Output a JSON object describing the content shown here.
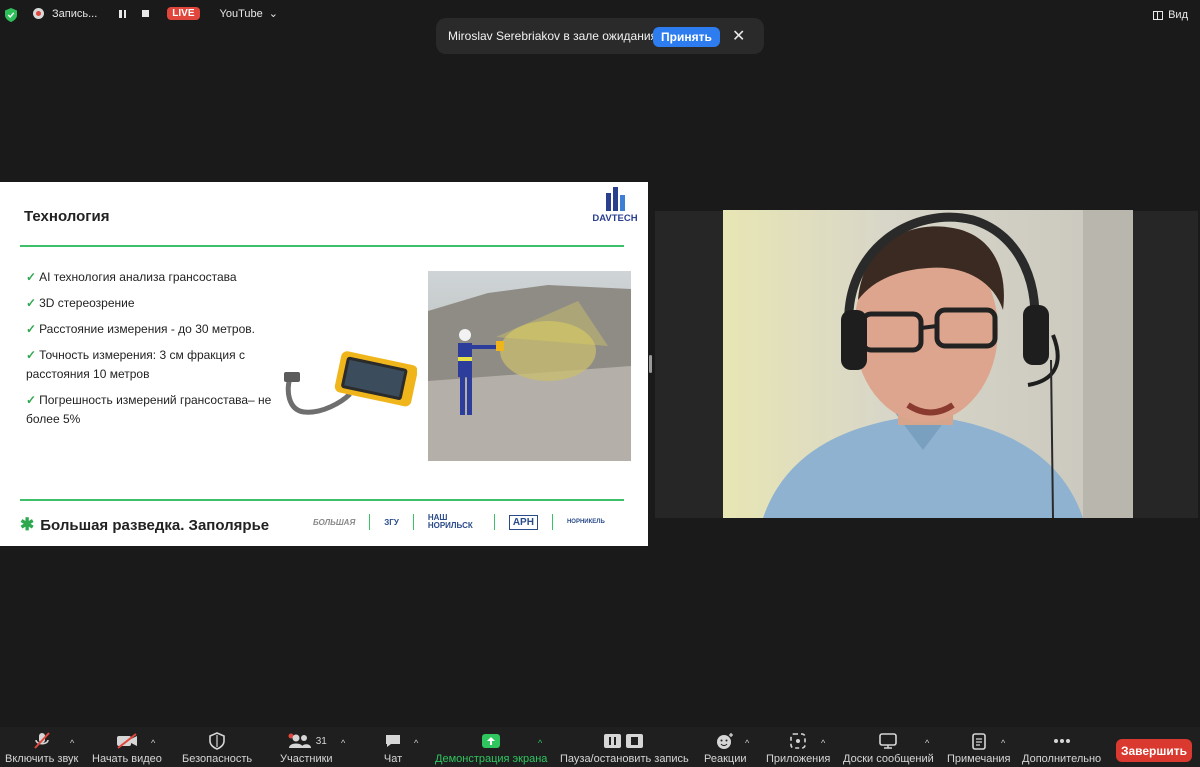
{
  "topbar": {
    "recording_label": "Запись...",
    "live_label": "LIVE",
    "stream_target": "YouTube",
    "view_label": "Вид"
  },
  "waiting_room": {
    "message": "Miroslav Serebriakov в зале ожидания",
    "accept_label": "Принять",
    "close_glyph": "✕"
  },
  "slide": {
    "title": "Технология",
    "brand": "DAVTECH",
    "bullets": [
      "AI технология анализа грансостава",
      "3D стереозрение",
      "Расстояние измерения - до 30 метров.",
      "Точность измерения: 3 см фракция с расстояния 10 метров",
      "Погрешность измерений грансостава– не более 5%"
    ],
    "footer_title": "Большая разведка. Заполярье",
    "footer_logos": [
      "БОЛЬШАЯ",
      "ЗГУ",
      "НАШ НОРИЛЬСК",
      "АРН",
      "НОРНИКЕЛЬ"
    ]
  },
  "toolbar": {
    "items": [
      {
        "label": "Включить звук",
        "icon": "mic-muted-icon"
      },
      {
        "label": "Начать видео",
        "icon": "video-off-icon"
      },
      {
        "label": "Безопасность",
        "icon": "shield-icon"
      },
      {
        "label": "Участники",
        "icon": "participants-icon",
        "count": "31"
      },
      {
        "label": "Чат",
        "icon": "chat-icon"
      },
      {
        "label": "Демонстрация экрана",
        "icon": "share-screen-icon"
      },
      {
        "label": "Пауза/остановить запись",
        "icon": "pause-stop-icon"
      },
      {
        "label": "Реакции",
        "icon": "reactions-icon"
      },
      {
        "label": "Приложения",
        "icon": "apps-icon"
      },
      {
        "label": "Доски сообщений",
        "icon": "whiteboard-icon"
      },
      {
        "label": "Примечания",
        "icon": "notes-icon"
      },
      {
        "label": "Дополнительно",
        "icon": "more-icon"
      }
    ],
    "end_label": "Завершить"
  },
  "colors": {
    "accent_blue": "#2d7cf0",
    "live_red": "#e0463c",
    "slide_green": "#3cc06a",
    "share_green": "#2fc55f",
    "end_red": "#d9392e"
  }
}
